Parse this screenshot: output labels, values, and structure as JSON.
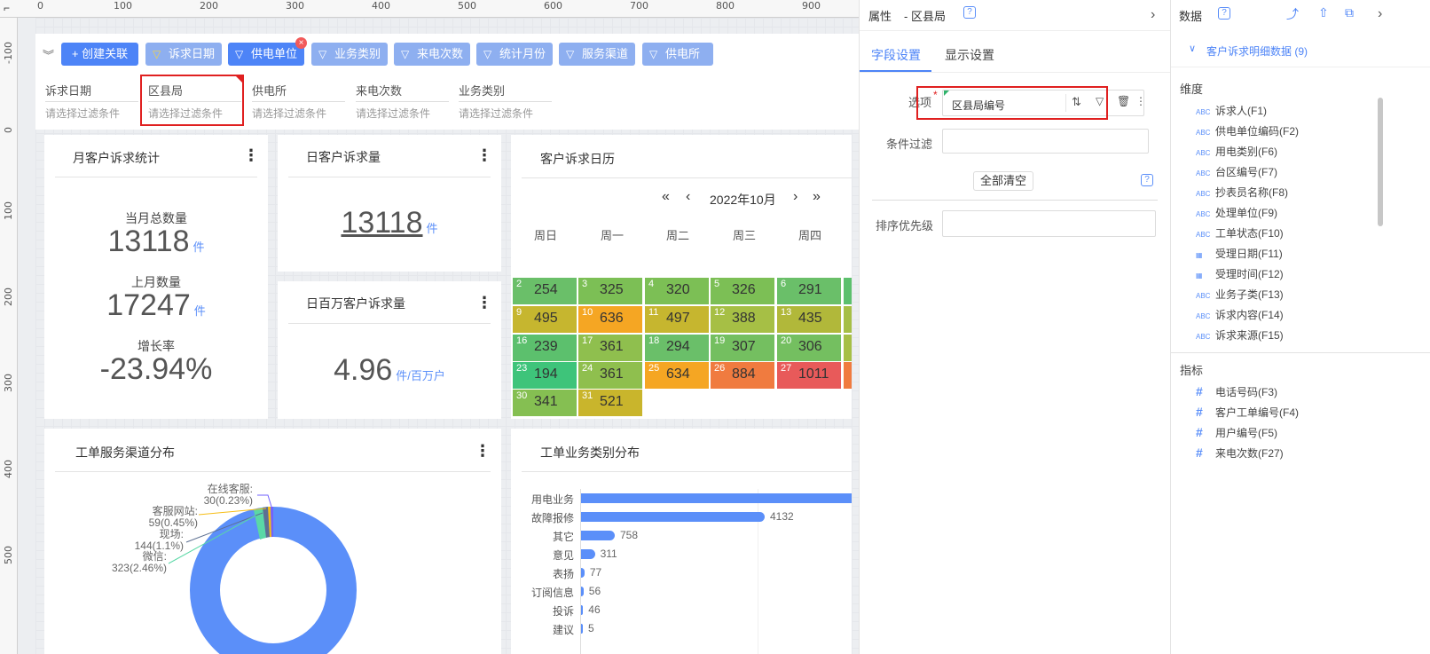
{
  "ruler": {
    "top": [
      "0",
      "100",
      "200",
      "300",
      "400",
      "500",
      "600",
      "700",
      "800",
      "900"
    ],
    "left": [
      "-100",
      "0",
      "100",
      "200",
      "300",
      "400",
      "500"
    ]
  },
  "toolbar": {
    "create_link": "+ 创建关联",
    "chips": [
      "诉求日期",
      "供电单位",
      "业务类别",
      "来电次数",
      "统计月份",
      "服务渠道",
      "供电所"
    ]
  },
  "filters": [
    {
      "label": "诉求日期",
      "placeholder": "请选择过滤条件"
    },
    {
      "label": "区县局",
      "placeholder": "请选择过滤条件"
    },
    {
      "label": "供电所",
      "placeholder": "请选择过滤条件"
    },
    {
      "label": "来电次数",
      "placeholder": "请选择过滤条件"
    },
    {
      "label": "业务类别",
      "placeholder": "请选择过滤条件"
    }
  ],
  "monthly": {
    "title": "月客户诉求统计",
    "total_label": "当月总数量",
    "total": "13118",
    "unit": "件",
    "last_label": "上月数量",
    "last": "17247",
    "growth_label": "增长率",
    "growth": "-23.94%"
  },
  "daily": {
    "title": "日客户诉求量",
    "value": "13118",
    "unit": "件"
  },
  "million": {
    "title": "日百万客户诉求量",
    "value": "4.96",
    "unit": "件/百万户"
  },
  "calendar": {
    "title": "客户诉求日历",
    "month": "2022年10月",
    "days": [
      "周日",
      "周一",
      "周二",
      "周三",
      "周四"
    ],
    "rows": [
      [
        {
          "d": "2",
          "v": "254",
          "c": "#6abf69"
        },
        {
          "d": "3",
          "v": "325",
          "c": "#7cbf55"
        },
        {
          "d": "4",
          "v": "320",
          "c": "#7cbf55"
        },
        {
          "d": "5",
          "v": "326",
          "c": "#7cbf55"
        },
        {
          "d": "6",
          "v": "291",
          "c": "#6abf69"
        }
      ],
      [
        {
          "d": "9",
          "v": "495",
          "c": "#c6b62f"
        },
        {
          "d": "10",
          "v": "636",
          "c": "#f5a623"
        },
        {
          "d": "11",
          "v": "497",
          "c": "#c6b62f"
        },
        {
          "d": "12",
          "v": "388",
          "c": "#a6bf45"
        },
        {
          "d": "13",
          "v": "435",
          "c": "#b1b83a"
        }
      ],
      [
        {
          "d": "16",
          "v": "239",
          "c": "#5cc06d"
        },
        {
          "d": "17",
          "v": "361",
          "c": "#8fbf4e"
        },
        {
          "d": "18",
          "v": "294",
          "c": "#6abf69"
        },
        {
          "d": "19",
          "v": "307",
          "c": "#74bf60"
        },
        {
          "d": "20",
          "v": "306",
          "c": "#74bf60"
        }
      ],
      [
        {
          "d": "23",
          "v": "194",
          "c": "#3ec47a"
        },
        {
          "d": "24",
          "v": "361",
          "c": "#8fbf4e"
        },
        {
          "d": "25",
          "v": "634",
          "c": "#f5a623"
        },
        {
          "d": "26",
          "v": "884",
          "c": "#f07b3f"
        },
        {
          "d": "27",
          "v": "1011",
          "c": "#e85a5a"
        }
      ],
      [
        {
          "d": "30",
          "v": "341",
          "c": "#85bf52"
        },
        {
          "d": "31",
          "v": "521",
          "c": "#c9b52c"
        }
      ]
    ]
  },
  "channel": {
    "title": "工单服务渠道分布",
    "labels": [
      {
        "name": "在线客服:",
        "val": "30(0.23%)"
      },
      {
        "name": "客服网站:",
        "val": "59(0.45%)"
      },
      {
        "name": "现场:",
        "val": "144(1.1%)"
      },
      {
        "name": "微信:",
        "val": "323(2.46%)"
      }
    ]
  },
  "chart_data": {
    "type": "bar",
    "title": "工单业务类别分布",
    "categories": [
      "用电业务",
      "故障报修",
      "其它",
      "意见",
      "表扬",
      "订阅信息",
      "投诉",
      "建议"
    ],
    "values": [
      null,
      4132,
      758,
      311,
      77,
      56,
      46,
      5
    ]
  },
  "props": {
    "title": "属性",
    "subtitle": "- 区县局",
    "tabs": [
      "字段设置",
      "显示设置"
    ],
    "option_label": "选项",
    "option_value": "区县局编号",
    "filter_label": "条件过滤",
    "clear_btn": "全部清空",
    "sort_label": "排序优先级"
  },
  "data_panel": {
    "title": "数据",
    "dataset": "客户诉求明细数据 (9)",
    "dim_title": "维度",
    "dims": [
      "诉求人(F1)",
      "供电单位编码(F2)",
      "用电类别(F6)",
      "台区编号(F7)",
      "抄表员名称(F8)",
      "处理单位(F9)",
      "工单状态(F10)",
      "受理日期(F11)",
      "受理时间(F12)",
      "业务子类(F13)",
      "诉求内容(F14)",
      "诉求来源(F15)"
    ],
    "measure_title": "指标",
    "measures": [
      "电话号码(F3)",
      "客户工单编号(F4)",
      "用户编号(F5)",
      "来电次数(F27)"
    ]
  },
  "colors": {
    "accent": "#5b8ff9",
    "chip": "#8eaff0",
    "highlight": "#e02020"
  }
}
